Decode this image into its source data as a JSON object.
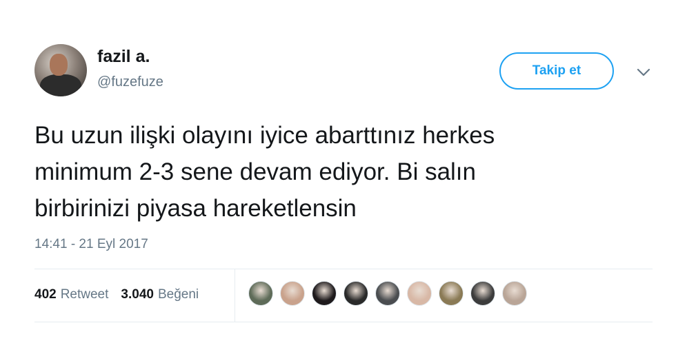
{
  "author": {
    "name": "fazil a.",
    "handle": "@fuzefuze"
  },
  "follow_button": {
    "label": "Takip et"
  },
  "tweet": {
    "lines": [
      "Bu uzun ilişki olayını iyice abarttınız herkes",
      "minimum 2-3 sene devam ediyor. Bi salın",
      "birbirinizi piyasa hareketlensin"
    ],
    "timestamp": "14:41 - 21 Eyl 2017"
  },
  "stats": {
    "retweet_count": "402",
    "retweet_label": "Retweet",
    "like_count": "3.040",
    "like_label": "Beğeni"
  },
  "likers": [
    {
      "color": "#5e6b58"
    },
    {
      "color": "#c9a28c"
    },
    {
      "color": "#1e1a1c"
    },
    {
      "color": "#2a2a2a"
    },
    {
      "color": "#4a4d50"
    },
    {
      "color": "#d8b8a6"
    },
    {
      "color": "#8a7a55"
    },
    {
      "color": "#3c3c3c"
    },
    {
      "color": "#b9a597"
    }
  ]
}
